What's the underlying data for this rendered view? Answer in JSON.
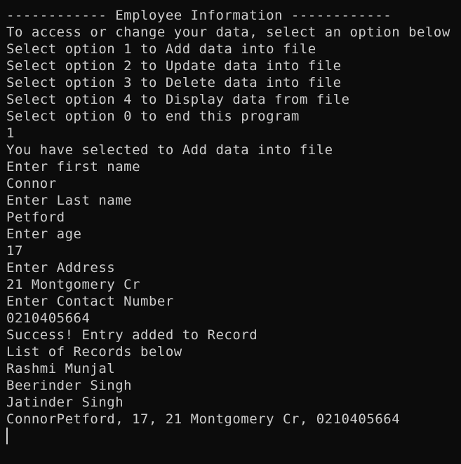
{
  "terminal": {
    "lines": [
      "------------ Employee Information ------------",
      "To access or change your data, select an option below",
      "Select option 1 to Add data into file",
      "Select option 2 to Update data into file",
      "Select option 3 to Delete data into file",
      "Select option 4 to Display data from file",
      "Select option 0 to end this program",
      "1",
      "You have selected to Add data into file",
      "Enter first name",
      "Connor",
      "Enter Last name",
      "Petford",
      "Enter age",
      "17",
      "Enter Address",
      "21 Montgomery Cr",
      "Enter Contact Number",
      "0210405664",
      "Success! Entry added to Record",
      "List of Records below",
      "Rashmi Munjal",
      "Beerinder Singh",
      "Jatinder Singh",
      "ConnorPetford, 17, 21 Montgomery Cr, 0210405664"
    ]
  },
  "colors": {
    "background": "#0c0c0c",
    "foreground": "#cccccc"
  }
}
